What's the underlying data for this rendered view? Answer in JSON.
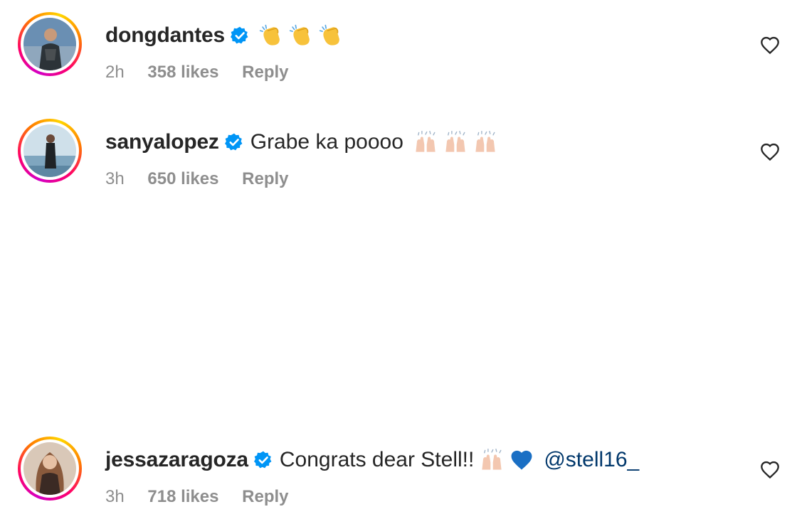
{
  "comments": [
    {
      "username": "dongdantes",
      "text": "",
      "emojis": [
        "clapping-hands",
        "clapping-hands",
        "clapping-hands"
      ],
      "time": "2h",
      "likes": "358 likes",
      "reply": "Reply"
    },
    {
      "username": "sanyalopez",
      "text": "Grabe ka poooo",
      "emojis": [
        "raising-hands",
        "raising-hands",
        "raising-hands"
      ],
      "time": "3h",
      "likes": "650 likes",
      "reply": "Reply"
    },
    {
      "username": "jessazaragoza",
      "text": "Congrats dear Stell!!",
      "emojis": [
        "raising-hands",
        "blue-heart"
      ],
      "mention": "@stell16_",
      "time": "3h",
      "likes": "718 likes",
      "reply": "Reply"
    }
  ],
  "colors": {
    "verified_blue": "#0095f6",
    "mention_blue": "#00376b",
    "meta_gray": "#8e8e8e"
  }
}
